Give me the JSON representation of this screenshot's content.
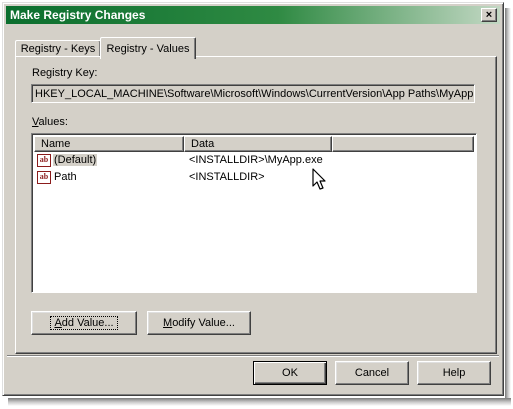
{
  "window": {
    "title": "Make Registry Changes",
    "close_glyph": "×"
  },
  "tabs": [
    {
      "label": "Registry - Keys",
      "active": false
    },
    {
      "label": "Registry - Values",
      "active": true
    }
  ],
  "registry_key": {
    "label": "Registry Key:",
    "value": "HKEY_LOCAL_MACHINE\\Software\\Microsoft\\Windows\\CurrentVersion\\App Paths\\MyApp."
  },
  "values": {
    "label_prefix": "V",
    "label_rest": "alues:",
    "columns": [
      "Name",
      "Data"
    ],
    "rows": [
      {
        "icon": "string-value-icon",
        "name": "(Default)",
        "data": "<INSTALLDIR>\\MyApp.exe",
        "selected": true
      },
      {
        "icon": "string-value-icon",
        "name": "Path",
        "data": "<INSTALLDIR>",
        "selected": false
      }
    ]
  },
  "buttons": {
    "add_value": {
      "mnemonic": "A",
      "rest": "dd Value..."
    },
    "modify_value": {
      "mnemonic": "M",
      "rest": "odify Value..."
    },
    "ok": "OK",
    "cancel": "Cancel",
    "help": "Help"
  },
  "colors": {
    "title_start": "#0b6e2e",
    "title_end": "#c3d8c4",
    "face": "#d4d0c8"
  }
}
